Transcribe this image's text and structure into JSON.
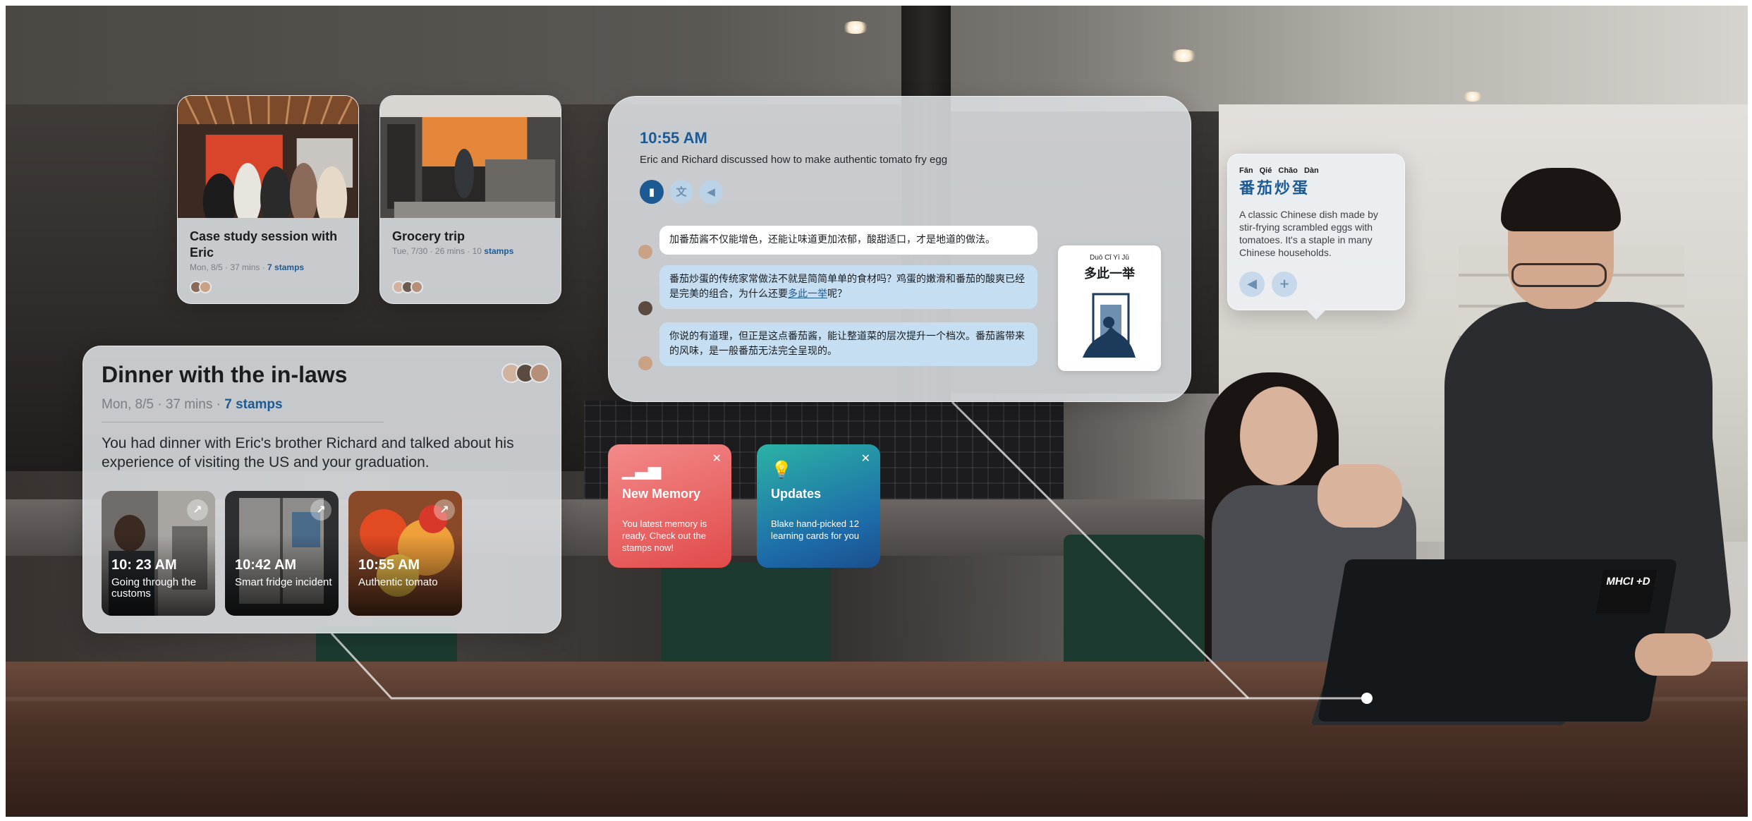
{
  "sessions": [
    {
      "title": "Case study session with Eric",
      "meta": "Mon, 8/5 · 37 mins · ",
      "stamps": "7 stamps"
    },
    {
      "title": "Grocery trip",
      "meta": "Tue, 7/30 · 26 mins · 10 ",
      "stamps": "stamps"
    }
  ],
  "dinner": {
    "title": "Dinner with the in-laws",
    "meta": "Mon, 8/5 · 37 mins · ",
    "stamps": "7 stamps",
    "summary": "You had dinner with Eric's brother Richard and talked about his experience of visiting the US and your graduation.",
    "moments": [
      {
        "time": "10: 23 AM",
        "desc": "Going through the customs"
      },
      {
        "time": "10:42 AM",
        "desc": "Smart fridge incident"
      },
      {
        "time": "10:55 AM",
        "desc": "Authentic tomato"
      }
    ]
  },
  "conversation": {
    "time": "10:55 AM",
    "subtitle": "Eric and Richard discussed how to make authentic tomato fry egg",
    "messages": [
      {
        "text": "加番茄酱不仅能增色，还能让味道更加浓郁，酸甜适口，才是地道的做法。"
      },
      {
        "text_before": "番茄炒蛋的传统家常做法不就是简简单单的食材吗？鸡蛋的嫩滑和番茄的酸爽已经是完美的组合，为什么还要",
        "highlight": "多此一举",
        "text_after": "呢？"
      },
      {
        "text": "你说的有道理，但正是这点番茄酱，能让整道菜的层次提升一个档次。番茄酱带来的风味，是一般番茄无法完全呈现的。"
      }
    ],
    "idiom_card": {
      "pinyin": "Duō Cǐ   Yì   Jǔ",
      "hanzi": "多此一举"
    }
  },
  "tiles": {
    "memory": {
      "label": "New Memory",
      "body": "You latest memory is ready. Check out the stamps now!"
    },
    "updates": {
      "label": "Updates",
      "body": "Blake hand-picked 12 learning cards for you"
    }
  },
  "dictionary": {
    "pinyin": "Fān Qié Chǎo Dàn",
    "hanzi": "番茄炒蛋",
    "definition": "A classic Chinese dish made by stir-frying scrambled eggs with tomatoes. It's a staple in many Chinese households."
  },
  "icons": {
    "bookmark": "bookmark-icon",
    "translate": "translate-icon",
    "speaker": "speaker-icon",
    "plus": "plus-icon",
    "open": "arrow-up-right-icon",
    "close": "close-icon",
    "memory": "sound-wave-icon",
    "updates": "lightbulb-icon"
  },
  "laptop_sticker": "MHCI +D",
  "colors": {
    "accent": "#1c5a94",
    "memory": "#e14a4a",
    "updates": "#1d6aa8"
  }
}
